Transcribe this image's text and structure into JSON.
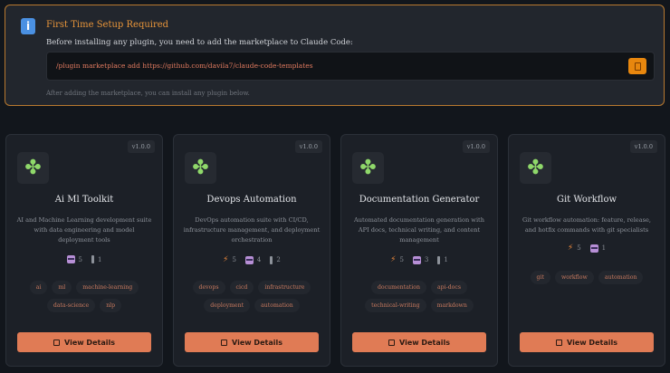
{
  "banner": {
    "title": "First Time Setup Required",
    "text": "Before installing any plugin, you need to add the marketplace to Claude Code:",
    "command": "/plugin marketplace add https://github.com/davila7/claude-code-templates",
    "note": "After adding the marketplace, you can install any plugin below."
  },
  "view_label": "View Details",
  "plugins": [
    {
      "version": "v1.0.0",
      "title": "Ai Ml Toolkit",
      "desc": "AI and Machine Learning development suite with data engineering and model deployment tools",
      "stats": [
        {
          "icon": "robot-icon",
          "value": "5"
        },
        {
          "icon": "plug-icon",
          "value": "1"
        }
      ],
      "tags": [
        "ai",
        "ml",
        "machine-learning",
        "data-science",
        "nlp"
      ]
    },
    {
      "version": "v1.0.0",
      "title": "Devops Automation",
      "desc": "DevOps automation suite with CI/CD, infrastructure management, and deployment orchestration",
      "stats": [
        {
          "icon": "lightning-icon",
          "value": "5"
        },
        {
          "icon": "robot-icon",
          "value": "4"
        },
        {
          "icon": "plug-icon",
          "value": "2"
        }
      ],
      "tags": [
        "devops",
        "cicd",
        "infrastructure",
        "deployment",
        "automation"
      ]
    },
    {
      "version": "v1.0.0",
      "title": "Documentation Generator",
      "desc": "Automated documentation generation with API docs, technical writing, and content management",
      "stats": [
        {
          "icon": "lightning-icon",
          "value": "5"
        },
        {
          "icon": "robot-icon",
          "value": "3"
        },
        {
          "icon": "plug-icon",
          "value": "1"
        }
      ],
      "tags": [
        "documentation",
        "api-docs",
        "technical-writing",
        "markdown"
      ]
    },
    {
      "version": "v1.0.0",
      "title": "Git Workflow",
      "desc": "Git workflow automation: feature, release, and hotfix commands with git specialists",
      "stats": [
        {
          "icon": "lightning-icon",
          "value": "5"
        },
        {
          "icon": "robot-icon",
          "value": "1"
        }
      ],
      "tags": [
        "git",
        "workflow",
        "automation"
      ]
    }
  ]
}
